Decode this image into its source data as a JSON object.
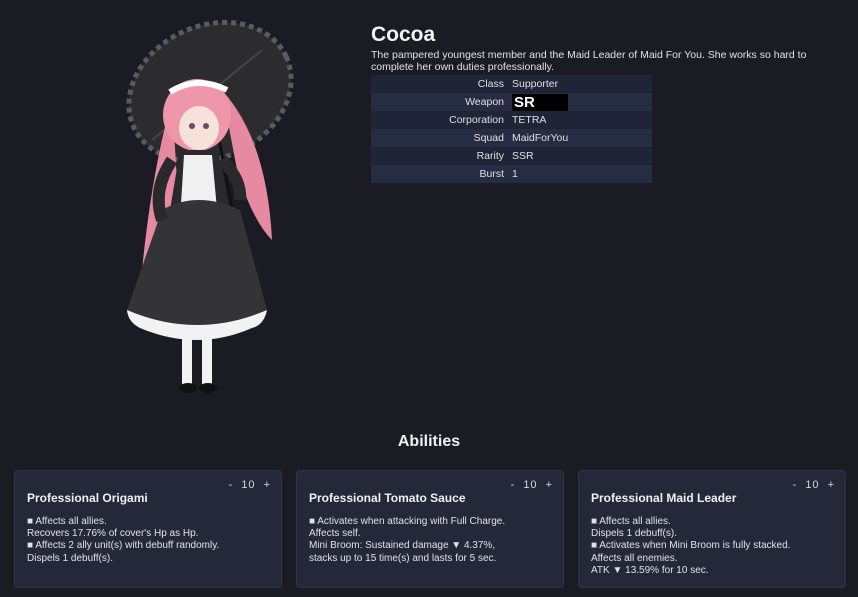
{
  "character": {
    "name": "Cocoa",
    "description": "The pampered youngest member and the Maid Leader of Maid For You. She works so hard to complete her own duties professionally.",
    "stats": [
      {
        "key": "Class",
        "value": "Supporter"
      },
      {
        "key": "Weapon",
        "value": "SR"
      },
      {
        "key": "Corporation",
        "value": "TETRA"
      },
      {
        "key": "Squad",
        "value": "MaidForYou"
      },
      {
        "key": "Rarity",
        "value": "SSR"
      },
      {
        "key": "Burst",
        "value": "1"
      }
    ]
  },
  "abilities": {
    "title": "Abilities",
    "cards": [
      {
        "name": "Professional Origami",
        "minus": "-",
        "level": "10",
        "plus": "+",
        "lines": [
          "■ Affects all allies.",
          "Recovers 17.76% of cover's Hp as Hp.",
          "■ Affects 2 ally unit(s) with debuff randomly.",
          "Dispels 1 debuff(s)."
        ]
      },
      {
        "name": "Professional Tomato Sauce",
        "minus": "-",
        "level": "10",
        "plus": "+",
        "lines": [
          "■ Activates when attacking with Full Charge.",
          "Affects self.",
          "Mini Broom: Sustained damage ▼ 4.37%,",
          "stacks up to 15 time(s) and lasts for 5 sec."
        ]
      },
      {
        "name": "Professional Maid Leader",
        "minus": "-",
        "level": "10",
        "plus": "+",
        "lines": [
          "■ Affects all allies.",
          "Dispels 1 debuff(s).",
          "■ Activates when Mini Broom is fully stacked.",
          "Affects all enemies.",
          "ATK ▼ 13.59% for 10 sec."
        ]
      }
    ]
  }
}
